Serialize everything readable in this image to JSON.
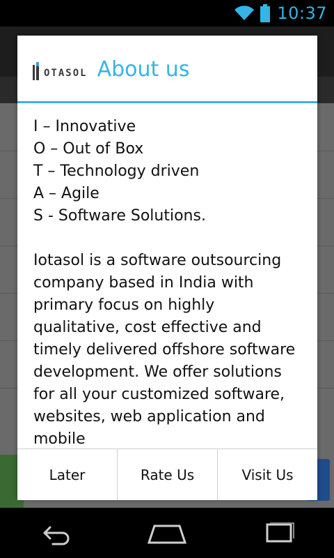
{
  "status_bar": {
    "time": "10:37",
    "icons": [
      "wifi-icon",
      "battery-icon"
    ],
    "accent_color": "#33b5e5"
  },
  "dialog": {
    "logo": {
      "wordmark": "OTASOL"
    },
    "title": "About us",
    "acronym_lines": [
      "I – Innovative",
      "O – Out of Box",
      "T – Technology driven",
      "A – Agile",
      "S - Software Solutions."
    ],
    "description": "Iotasol is a software outsourcing company based in India with primary focus on highly qualitative, cost effective and timely delivered offshore software development. We offer solutions for all your customized software, websites, web application and mobile",
    "buttons": {
      "later": "Later",
      "rate_us": "Rate Us",
      "visit_us": "Visit Us"
    },
    "title_color": "#33b5e5"
  },
  "nav_bar": {
    "icons": [
      "back-icon",
      "home-icon",
      "recent-apps-icon"
    ]
  }
}
